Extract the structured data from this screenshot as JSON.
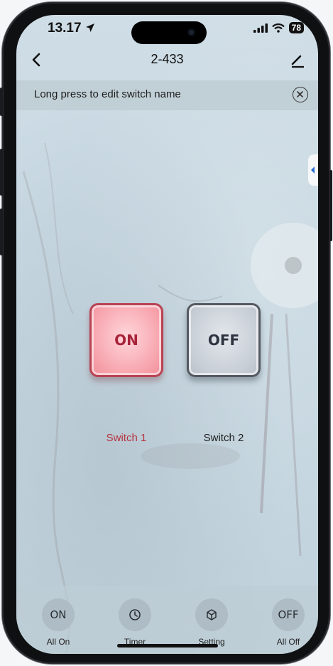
{
  "status": {
    "time": "13.17",
    "battery": "78"
  },
  "nav": {
    "title": "2-433"
  },
  "banner": {
    "text": "Long press to edit switch name"
  },
  "switches": [
    {
      "state_label": "ON",
      "name": "Switch 1",
      "state": "on",
      "color": "#b5333f"
    },
    {
      "state_label": "OFF",
      "name": "Switch 2",
      "state": "off",
      "color": "#1e1e1e"
    }
  ],
  "bottom_bar": [
    {
      "icon_text": "ON",
      "label": "All On"
    },
    {
      "icon": "clock-icon",
      "label": "Timer"
    },
    {
      "icon": "cube-icon",
      "label": "Setting"
    },
    {
      "icon_text": "OFF",
      "label": "All Off"
    }
  ]
}
